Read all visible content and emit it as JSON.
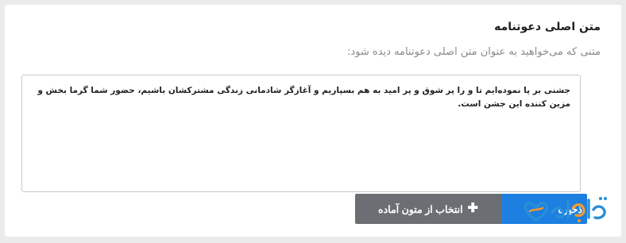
{
  "section": {
    "title": "متن اصلی دعوتنامه",
    "hint": "متنی که می‌خواهید به عنوان متن اصلی دعوتنامه دیده شود:"
  },
  "invitation_text": {
    "value": "جشنی بر پا نموده‌ایم تا و را پر شوق و پر امید به هم بسپاریم و آغازگر شادمانی زندگی مشترکشان باشیم، حضور شما گرما بخش و مزین کننده این جشن است."
  },
  "actions": {
    "save_label": "ذخیره",
    "select_ready_label": "انتخاب از متون آماده",
    "select_ready_icon": "plus-icon"
  },
  "logo": {
    "text": "تالار"
  },
  "colors": {
    "save_bg": "#1d7fe0",
    "select_bg": "#6b6f73",
    "logo_blue": "#2a8fd8",
    "logo_orange": "#f39a2b"
  }
}
